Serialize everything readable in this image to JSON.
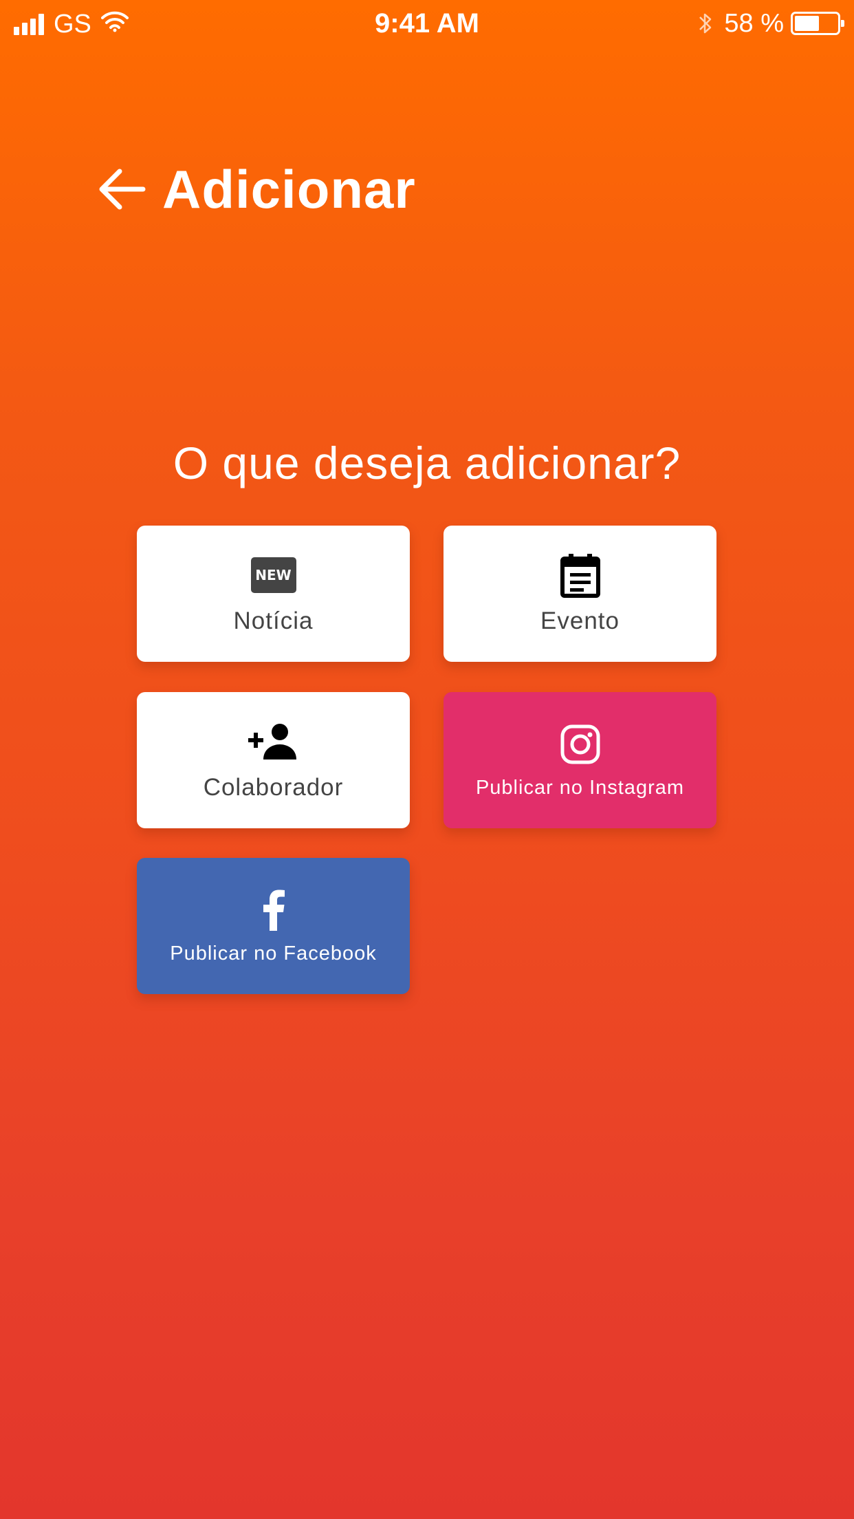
{
  "status_bar": {
    "carrier": "GS",
    "time": "9:41 AM",
    "battery_percent": "58 %",
    "battery_level": 0.58,
    "icons": [
      "signal-icon",
      "wifi-icon",
      "bluetooth-icon",
      "battery-icon"
    ]
  },
  "header": {
    "title": "Adicionar",
    "back_icon": "arrow-left-icon"
  },
  "question": "O que deseja adicionar?",
  "options": [
    {
      "label": "Notícia",
      "icon": "new-badge-icon",
      "icon_text": "NEW",
      "color": "#ffffff"
    },
    {
      "label": "Evento",
      "icon": "calendar-event-icon",
      "color": "#ffffff"
    },
    {
      "label": "Colaborador",
      "icon": "person-add-icon",
      "color": "#ffffff"
    },
    {
      "label": "Publicar no Instagram",
      "icon": "instagram-icon",
      "color": "#e22e6a"
    },
    {
      "label": "Publicar no Facebook",
      "icon": "facebook-icon",
      "color": "#4367b1"
    }
  ],
  "colors": {
    "gradient_top": "#ff6c00",
    "gradient_bottom": "#e3362c",
    "card_text": "#444444"
  }
}
